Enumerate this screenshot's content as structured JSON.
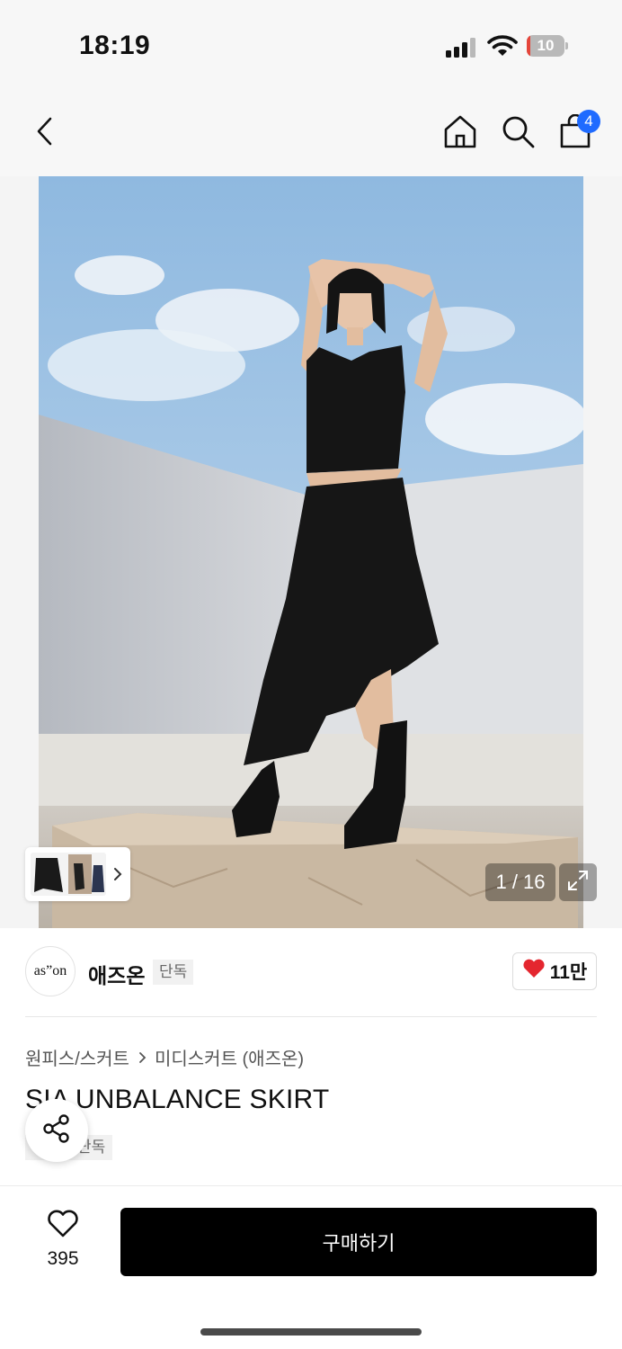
{
  "status_bar": {
    "time": "18:19",
    "battery": "10",
    "battery_level": 0.1,
    "icons": [
      "signal-icon",
      "wifi-icon",
      "battery-icon"
    ]
  },
  "nav": {
    "icons": [
      "back-arrow-icon",
      "home-icon",
      "search-icon",
      "shopping-bag-icon"
    ],
    "cart_count": "4",
    "badge_color": "#1f6bff"
  },
  "gallery": {
    "counter": "1 / 16",
    "icons": [
      "chevron-right-icon",
      "expand-icon"
    ]
  },
  "brand": {
    "logo_text": "as”on",
    "name": "애즈온",
    "tag": "단독",
    "likes": "11만",
    "heart_color": "#e4262f"
  },
  "breadcrumb": {
    "items": [
      "원피스/스커트",
      "미디스커트 (애즈온)"
    ]
  },
  "product": {
    "title": "SIA UNBALANCE SKIRT",
    "tag": "단독"
  },
  "share": {
    "icon": "share-icon"
  },
  "bottom_bar": {
    "wish_count": "395",
    "buy_label": "구매하기"
  }
}
